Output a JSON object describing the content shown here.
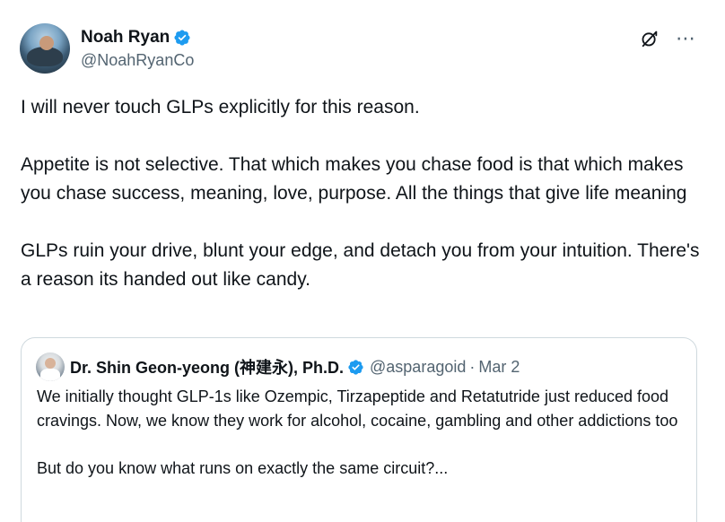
{
  "author": {
    "display_name": "Noah Ryan",
    "handle": "@NoahRyanCo",
    "verified": true
  },
  "icons": {
    "verified": "verified-badge-icon",
    "grok": "grok-icon",
    "more": "more-icon"
  },
  "colors": {
    "verified_blue": "#1d9bf0",
    "text_primary": "#0f1419",
    "text_secondary": "#536471",
    "border": "#cfd9de"
  },
  "tweet": {
    "paragraph_1": "I will never touch GLPs explicitly for this reason.",
    "paragraph_2": "Appetite is not selective. That which makes you chase food is that which makes you chase success, meaning, love, purpose. All the things that give life meaning",
    "paragraph_3": "GLPs ruin your drive, blunt your edge, and detach you from your intuition. There's a reason its handed out like candy."
  },
  "quote": {
    "display_name": "Dr. Shin Geon-yeong (神建永), Ph.D.",
    "handle": "@asparagoid",
    "separator": "·",
    "date": "Mar 2",
    "paragraph_1": "We initially thought GLP-1s like Ozempic, Tirzapeptide and Retatutride just reduced food cravings. Now, we know they work for alcohol, cocaine, gambling and other addictions too",
    "paragraph_2": "But do you know what runs on exactly the same circuit?..."
  }
}
